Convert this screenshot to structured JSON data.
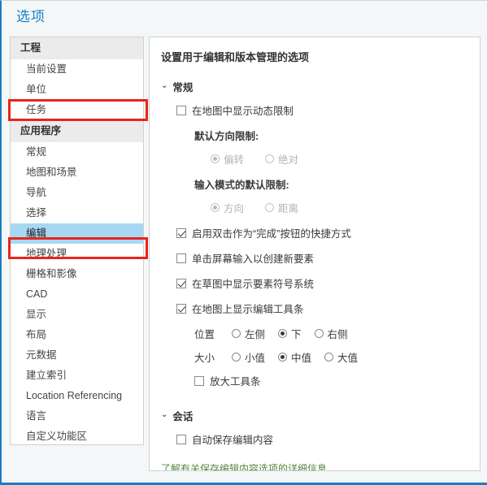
{
  "window": {
    "title": "选项",
    "accent_color": "#1b7fc4",
    "highlight_color": "#a7d8f3",
    "annotation_color": "#e8251b",
    "link_color": "#56843f"
  },
  "sidebar": {
    "groups": [
      {
        "header": "工程",
        "items": [
          {
            "label": "当前设置",
            "selected": false
          },
          {
            "label": "单位",
            "selected": false
          },
          {
            "label": "任务",
            "selected": false
          }
        ]
      },
      {
        "header": "应用程序",
        "items": [
          {
            "label": "常规",
            "selected": false
          },
          {
            "label": "地图和场景",
            "selected": false
          },
          {
            "label": "导航",
            "selected": false
          },
          {
            "label": "选择",
            "selected": false
          },
          {
            "label": "编辑",
            "selected": true
          },
          {
            "label": "地理处理",
            "selected": false
          },
          {
            "label": "栅格和影像",
            "selected": false
          },
          {
            "label": "CAD",
            "selected": false
          },
          {
            "label": "显示",
            "selected": false
          },
          {
            "label": "布局",
            "selected": false
          },
          {
            "label": "元数据",
            "selected": false
          },
          {
            "label": "建立索引",
            "selected": false
          },
          {
            "label": "Location Referencing",
            "selected": false
          },
          {
            "label": "语言",
            "selected": false
          },
          {
            "label": "自定义功能区",
            "selected": false
          }
        ]
      }
    ]
  },
  "main": {
    "heading": "设置用于编辑和版本管理的选项",
    "chevron_glyph": "⌄",
    "sections": [
      {
        "title": "常规",
        "expanded": true
      },
      {
        "title": "会话",
        "expanded": true
      }
    ],
    "general": {
      "show_dynamic_constraints": {
        "label": "在地图中显示动态限制",
        "checked": false
      },
      "default_direction_label": "默认方向限制:",
      "direction_options": [
        {
          "label": "偏转",
          "selected": true
        },
        {
          "label": "绝对",
          "selected": false
        }
      ],
      "direction_disabled": true,
      "default_input_mode_label": "输入模式的默认限制:",
      "input_mode_options": [
        {
          "label": "方向",
          "selected": true
        },
        {
          "label": "距离",
          "selected": false
        }
      ],
      "input_mode_disabled": true,
      "double_click_finish": {
        "label": "启用双击作为“完成”按钮的快捷方式",
        "checked": true
      },
      "click_screen_create": {
        "label": "单击屏幕输入以创建新要素",
        "checked": false
      },
      "show_symbology_sketch": {
        "label": "在草图中显示要素符号系统",
        "checked": true
      },
      "show_edit_toolbar": {
        "label": "在地图上显示编辑工具条",
        "checked": true
      },
      "position_label": "位置",
      "position_options": [
        {
          "label": "左侧",
          "selected": false
        },
        {
          "label": "下",
          "selected": true
        },
        {
          "label": "右侧",
          "selected": false
        }
      ],
      "size_label": "大小",
      "size_options": [
        {
          "label": "小值",
          "selected": false
        },
        {
          "label": "中值",
          "selected": true
        },
        {
          "label": "大值",
          "selected": false
        }
      ],
      "magnify_toolbar": {
        "label": "放大工具条",
        "checked": false
      }
    },
    "session": {
      "auto_save": {
        "label": "自动保存编辑内容",
        "checked": false
      },
      "learn_more_link": "了解有关保存编辑内容选项的详细信息"
    }
  }
}
